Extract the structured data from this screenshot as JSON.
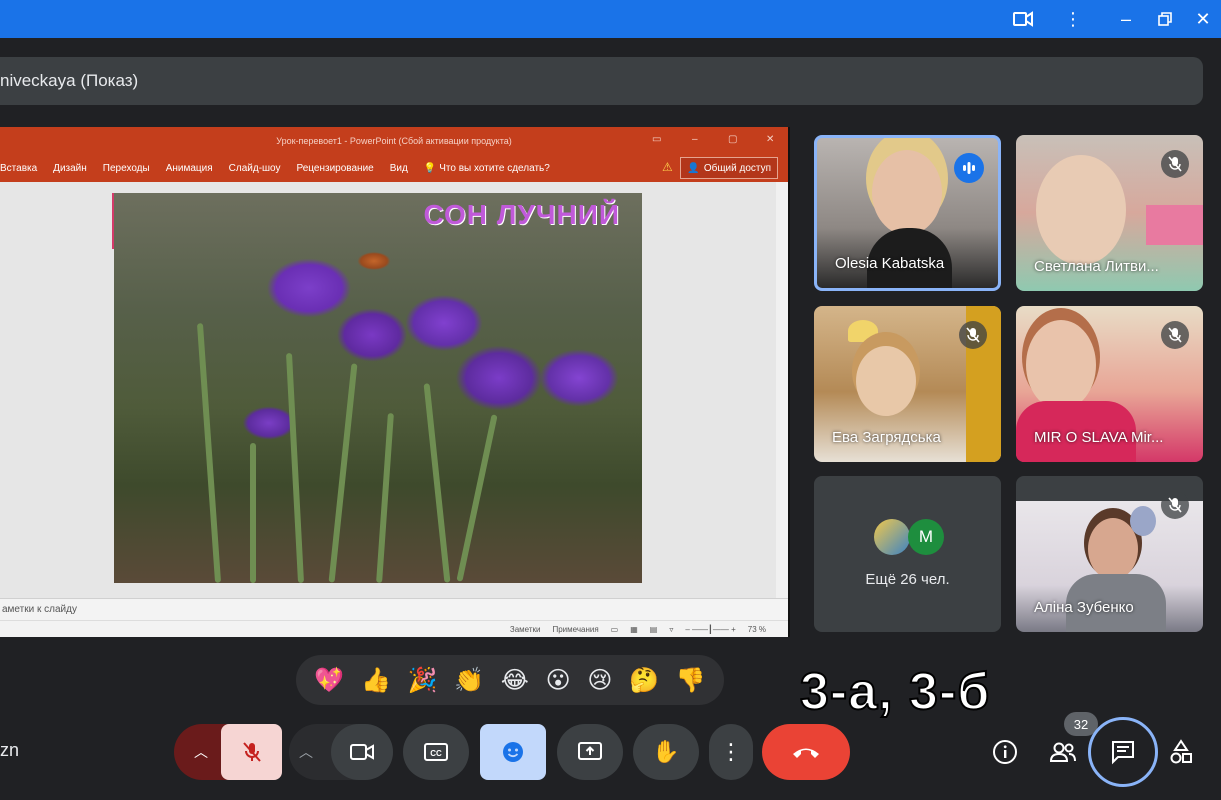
{
  "window": {
    "controls": [
      "camera-icon",
      "more-vert-icon",
      "minimize-icon",
      "restore-icon",
      "close-icon"
    ]
  },
  "banner": {
    "presenter_text": "niveckaya (Показ)"
  },
  "powerpoint": {
    "title": "Урок-перевоет1 - PowerPoint (Сбой активации продукта)",
    "ribbon_tabs": [
      "Вставка",
      "Дизайн",
      "Переходы",
      "Анимация",
      "Слайд-шоу",
      "Рецензирование",
      "Вид"
    ],
    "tell_me": "Что вы хотите сделать?",
    "share": "Общий доступ",
    "slide_title": "СОН ЛУЧНИЙ",
    "notes_placeholder": "аметки к слайду",
    "status": {
      "notes": "Заметки",
      "comments": "Примечания",
      "zoom": "73 %"
    }
  },
  "participants": [
    {
      "name": "Olesia Kabatska",
      "state": "speaking"
    },
    {
      "name": "Светлана Литви...",
      "state": "muted"
    },
    {
      "name": "Ева Загрядська",
      "state": "muted"
    },
    {
      "name": "MIR O SLAVA Mir...",
      "state": "muted"
    },
    {
      "name": "Ещё 26 чел.",
      "state": "overflow",
      "avatar_letter": "M",
      "avatar_color": "#1e8e3e"
    },
    {
      "name": "Аліна Зубенко",
      "state": "muted"
    }
  ],
  "reactions": [
    "💖",
    "👍",
    "🎉",
    "👏",
    "😂",
    "😮",
    "😢",
    "🤔",
    "👎"
  ],
  "overlay_label": "3-а, 3-б",
  "controls": {
    "left_caption": "zn",
    "people_count": "32",
    "end_color": "#ea4335",
    "accent": "#1a73e8"
  }
}
